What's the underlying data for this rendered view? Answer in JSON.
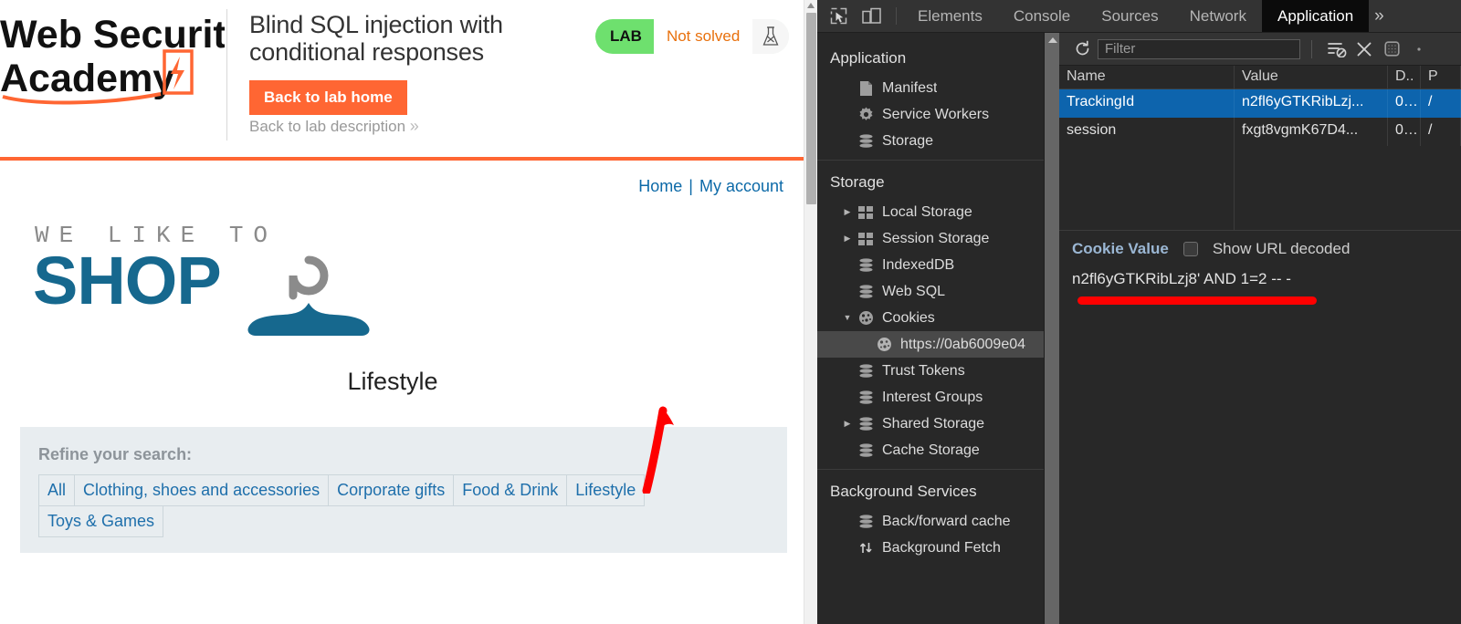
{
  "lab": {
    "logo_line1": "Web Security",
    "logo_line2": "Academy",
    "title": "Blind SQL injection with conditional responses",
    "back_home_label": "Back to lab home",
    "back_desc_label": "Back to lab description",
    "back_desc_chevron": "»",
    "status_tag": "LAB",
    "status_state": "Not solved",
    "accent_color": "#ff6633",
    "status_green": "#6ee06e",
    "status_text_color": "#e8700c"
  },
  "shop": {
    "nav": [
      {
        "label": "Home"
      },
      {
        "label": "My account"
      }
    ],
    "nav_separator": "|",
    "brand_small": "WE LIKE TO",
    "brand_big": "SHOP",
    "brand_color": "#16688e",
    "category_title": "Lifestyle",
    "refine_label": "Refine your search:",
    "filters": [
      "All",
      "Clothing, shoes and accessories",
      "Corporate gifts",
      "Food & Drink",
      "Lifestyle",
      "Toys & Games"
    ],
    "filter_link_color": "#1e6fab"
  },
  "annotation": {
    "arrow_color": "#fe0000",
    "underline_color": "#fe0000"
  },
  "devtools": {
    "tabs": [
      {
        "label": "Elements",
        "active": false
      },
      {
        "label": "Console",
        "active": false
      },
      {
        "label": "Sources",
        "active": false
      },
      {
        "label": "Network",
        "active": false
      },
      {
        "label": "Application",
        "active": true
      }
    ],
    "overflow_label": "»",
    "sidebar": {
      "groups": [
        {
          "title": "Application",
          "items": [
            {
              "label": "Manifest",
              "icon": "document-icon",
              "twisty": "",
              "selected": false,
              "indent": 1
            },
            {
              "label": "Service Workers",
              "icon": "gear-icon",
              "twisty": "",
              "selected": false,
              "indent": 1
            },
            {
              "label": "Storage",
              "icon": "database-icon",
              "twisty": "",
              "selected": false,
              "indent": 1
            }
          ]
        },
        {
          "title": "Storage",
          "items": [
            {
              "label": "Local Storage",
              "icon": "table-icon",
              "twisty": "▶",
              "selected": false,
              "indent": 1
            },
            {
              "label": "Session Storage",
              "icon": "table-icon",
              "twisty": "▶",
              "selected": false,
              "indent": 1
            },
            {
              "label": "IndexedDB",
              "icon": "database-icon",
              "twisty": "",
              "selected": false,
              "indent": 1
            },
            {
              "label": "Web SQL",
              "icon": "database-icon",
              "twisty": "",
              "selected": false,
              "indent": 1
            },
            {
              "label": "Cookies",
              "icon": "cookie-icon",
              "twisty": "▼",
              "selected": false,
              "indent": 1
            },
            {
              "label": "https://0ab6009e04",
              "icon": "cookie-icon",
              "twisty": "",
              "selected": true,
              "indent": 2
            },
            {
              "label": "Trust Tokens",
              "icon": "database-icon",
              "twisty": "",
              "selected": false,
              "indent": 1
            },
            {
              "label": "Interest Groups",
              "icon": "database-icon",
              "twisty": "",
              "selected": false,
              "indent": 1
            },
            {
              "label": "Shared Storage",
              "icon": "database-icon",
              "twisty": "▶",
              "selected": false,
              "indent": 1
            },
            {
              "label": "Cache Storage",
              "icon": "database-icon",
              "twisty": "",
              "selected": false,
              "indent": 1
            }
          ]
        },
        {
          "title": "Background Services",
          "items": [
            {
              "label": "Back/forward cache",
              "icon": "database-icon",
              "twisty": "",
              "selected": false,
              "indent": 1
            },
            {
              "label": "Background Fetch",
              "icon": "updownarrows-icon",
              "twisty": "",
              "selected": false,
              "indent": 1
            }
          ]
        }
      ]
    },
    "toolbar": {
      "refresh_title": "Refresh",
      "filter_placeholder": "Filter",
      "filter_value": "",
      "clear_filtered_title": "Clear filtered cookies",
      "clear_all_title": "Clear all cookies",
      "only_problems_title": "Only show cookies with an issue"
    },
    "cookie_table": {
      "columns": [
        "Name",
        "Value",
        "D..",
        "P"
      ],
      "rows": [
        {
          "name": "TrackingId",
          "value": "n2fl6yGTKRibLzj...",
          "domain": "0...",
          "path": "/",
          "selected": true
        },
        {
          "name": "session",
          "value": "fxgt8vgmK67D4...",
          "domain": "0...",
          "path": "/",
          "selected": false
        }
      ]
    },
    "cookie_detail": {
      "title": "Cookie Value",
      "show_url_decoded_label": "Show URL decoded",
      "show_url_decoded_checked": false,
      "value": "n2fl6yGTKRibLzj8' AND 1=2 -- -"
    },
    "selected_row_color": "#0d64ad"
  }
}
